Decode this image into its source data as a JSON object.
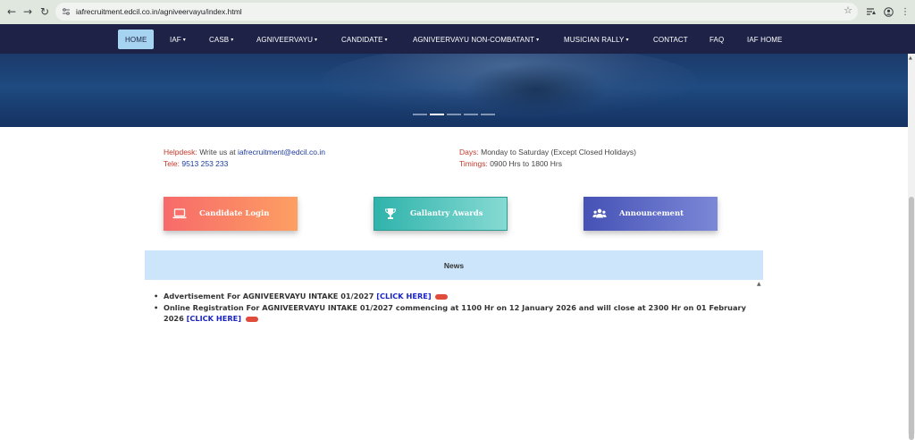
{
  "browser": {
    "url": "iafrecruitment.edcil.co.in/agniveervayu/index.html"
  },
  "nav": {
    "items": [
      {
        "label": "HOME",
        "dropdown": false
      },
      {
        "label": "IAF",
        "dropdown": true
      },
      {
        "label": "CASB",
        "dropdown": true
      },
      {
        "label": "AGNIVEERVAYU",
        "dropdown": true
      },
      {
        "label": "CANDIDATE",
        "dropdown": true
      },
      {
        "label": "AGNIVEERVAYU NON-COMBATANT",
        "dropdown": true
      },
      {
        "label": "MUSICIAN RALLY",
        "dropdown": true
      },
      {
        "label": "CONTACT",
        "dropdown": false
      },
      {
        "label": "FAQ",
        "dropdown": false
      },
      {
        "label": "IAF HOME",
        "dropdown": false
      }
    ],
    "caret": "▾"
  },
  "info": {
    "helpdesk_label": "Helpdesk:",
    "helpdesk_text": "Write us at",
    "helpdesk_email": "iafrecruitment@edcil.co.in",
    "tele_label": "Tele:",
    "tele_value": "9513 253 233",
    "days_label": "Days:",
    "days_value": "Monday to Saturday (Except Closed Holidays)",
    "timings_label": "Timings:",
    "timings_value": "0900 Hrs to 1800 Hrs"
  },
  "cards": {
    "login": "Candidate Login",
    "gallantry": "Gallantry Awards",
    "announcement": "Announcement"
  },
  "news": {
    "title": "News",
    "items": [
      {
        "text": "Advertisement For AGNIVEERVAYU INTAKE 01/2027",
        "link": "[CLICK HERE]"
      },
      {
        "text": "Online Registration For AGNIVEERVAYU INTAKE 01/2027 commencing at 1100 Hr on 12 January 2026 and will close at 2300 Hr on 01 February 2026",
        "link": "[CLICK HERE]"
      }
    ]
  },
  "icons": {
    "back": "arrow-left-icon",
    "forward": "arrow-right-icon",
    "reload": "reload-icon",
    "star": "star-icon",
    "login": "laptop-icon",
    "gallantry": "trophy-icon",
    "announcement": "users-icon"
  }
}
